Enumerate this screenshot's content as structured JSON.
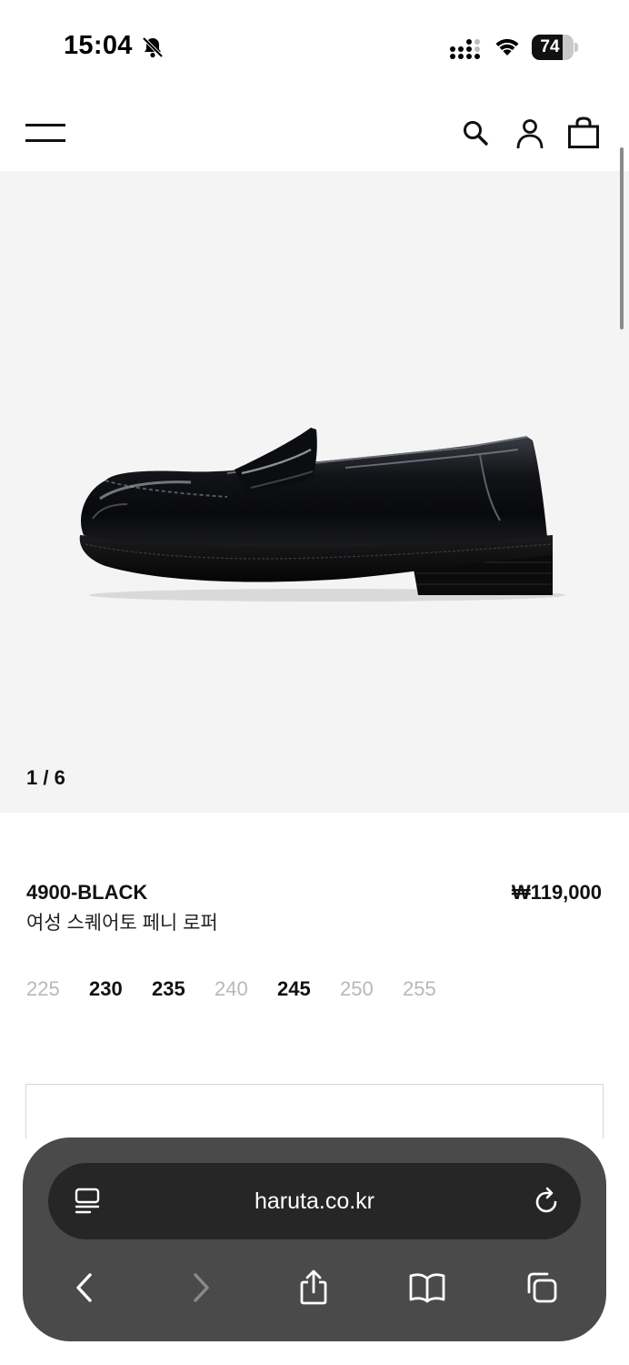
{
  "status_bar": {
    "time": "15:04",
    "battery_level": "74",
    "battery_fraction": 0.74
  },
  "header": {
    "icons": [
      "menu-icon",
      "search-icon",
      "user-icon",
      "shopping-bag-icon"
    ]
  },
  "gallery": {
    "counter": "1 / 6",
    "image": "shoe-image"
  },
  "product": {
    "code": "4900-BLACK",
    "name": "여성 스퀘어토 페니 로퍼",
    "price": "₩119,000",
    "sizes": [
      {
        "label": "225",
        "available": false
      },
      {
        "label": "230",
        "available": true
      },
      {
        "label": "235",
        "available": true
      },
      {
        "label": "240",
        "available": false
      },
      {
        "label": "245",
        "available": true
      },
      {
        "label": "250",
        "available": false
      },
      {
        "label": "255",
        "available": false
      }
    ]
  },
  "browser": {
    "url": "haruta.co.kr",
    "icons": [
      "reader-icon",
      "reload-icon",
      "back-icon",
      "forward-icon",
      "share-icon",
      "bookmarks-icon",
      "tabs-icon"
    ]
  },
  "colors": {
    "gallery_background": "#f4f4f4",
    "toolbar": "#4a4a4a",
    "url_bar": "#262626",
    "unavailable_size": "#b8b8b8"
  }
}
